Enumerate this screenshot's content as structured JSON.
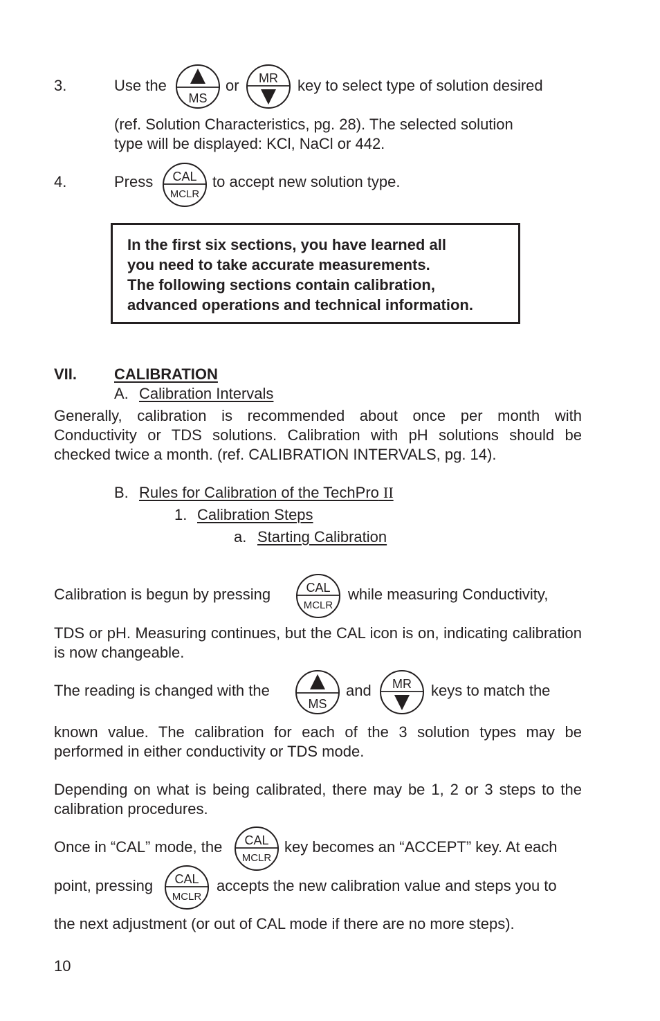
{
  "page": {
    "number": "10",
    "steps": [
      {
        "num": "3.",
        "pre": "Use the",
        "mid": "or",
        "post": "key to select type of solution desired",
        "cont1": "(ref. Solution Characteristics, pg. 28). The selected solution",
        "cont2": "type will be displayed: KCl, NaCl or 442."
      },
      {
        "num": "4.",
        "pre": "Press",
        "post": "to accept new solution type."
      }
    ],
    "notice": [
      "In the first six sections, you have learned all",
      "you need to take accurate measurements.",
      "The following sections contain calibration,",
      "advanced operations and technical information."
    ],
    "section": {
      "numeral": "VII.",
      "title": "CALIBRATION",
      "sub_a_letter": "A.",
      "sub_a_title": "Calibration Intervals",
      "intervals_text": "Generally, calibration is recommended about once per month with Conductivity or TDS solutions. Calibration with pH solutions should be checked twice a month. (ref. CALIBRATION INTERVALS, pg. 14).",
      "sub_b_letter": "B.",
      "sub_b_title": "Rules for Calibration of the TechPro",
      "sub_b_suffix": "II",
      "sub_1_num": "1.",
      "sub_1_title": "Calibration Steps",
      "sub_a2_letter": "a.",
      "sub_a2_title": "Starting Calibration"
    },
    "paragraphs": {
      "begun_pre": "Calibration is begun by pressing",
      "begun_post": "while measuring Conductivity,",
      "begun_cont": "TDS or pH. Measuring continues, but the CAL icon is on, indicating calibration is now changeable.",
      "reading_pre": "The reading is changed with the",
      "reading_mid": "and",
      "reading_post": "keys to match the",
      "reading_cont": "known value. The calibration for each of the 3 solution types may be performed in either conductivity or TDS mode.",
      "depending": "Depending on what is being calibrated, there may be 1, 2 or 3 steps to the calibration procedures.",
      "once_pre": "Once in “CAL” mode, the",
      "once_post": "key becomes an “ACCEPT” key. At each",
      "point_pre": "point, pressing",
      "point_post": "accepts the new calibration value and steps you to",
      "next": "the next adjustment (or out of CAL mode if there are no more steps)."
    },
    "keys": {
      "up_ms": {
        "top": "▲",
        "bottom": "MS"
      },
      "mr_down": {
        "top": "MR",
        "bottom": "▼"
      },
      "cal_mclr": {
        "top": "CAL",
        "bottom": "MCLR"
      }
    }
  }
}
